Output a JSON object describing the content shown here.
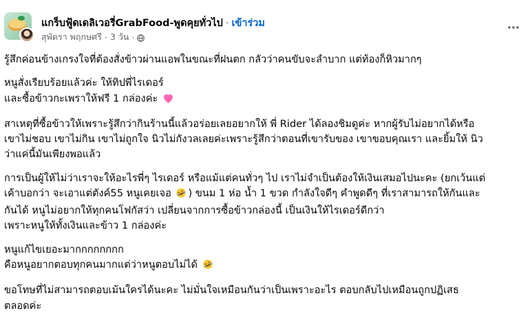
{
  "post": {
    "group_name": "แกร็บฟู้ดเดลิเวอรี่GrabFood-พูดคุยทั่วไป",
    "separator": "·",
    "join_label": "เข้าร่วม",
    "author": "สุพัตรา พฤกษศรี",
    "time": "3 วัน",
    "privacy_icon": "globe-icon",
    "more_icon": "more-options-icon",
    "paragraphs": [
      {
        "lines": [
          "รู้สึกค่อนข้างเกรงใจที่ต้องสั่งข้าวผ่านแอพในขณะที่ฝนตก กลัวว่าคนขับจะลำบาก แต่ท้องก็หิวมากๆ"
        ]
      },
      {
        "lines": [
          "หนูสั่งเรียบร้อยแล้วค่ะ ให้ทิปพี่ไรเดอร์",
          "และซื้อข้าวกะเพราให้ฟรี 1 กล่องค่ะ"
        ],
        "trailing_emoji": "pink-heart-emoji"
      },
      {
        "lines": [
          "สาเหตุที่ซื้อข้าวให้เพราะรู้สึกว่ากินร้านนี้แล้วอร่อยเลยอยากให้ พี่ Rider ได้ลองชิมดูค่ะ หากผู้รับไม่อยากได้หรือ",
          "เขาไม่ชอบ เขาไม่กิน เขาไม่ถูกใจ นิวไม่กังวลเลยค่ะเพราะรู้สึกว่าตอนที่เขารับของ เขาขอบคุณเรา และยิ้มให้ นิว",
          "ว่าแค่นี้มันเพียงพอแล้ว"
        ]
      },
      {
        "lines_parts": [
          [
            "การเป็นผู้ให้ไม่ว่าเราจะให้อะไรพี่ๆ ไรเดอร์ หรือแม้แต่คนทั่วๆ ไป เราไม่จำเป็นต้องให้เงินเสมอไปนะคะ (ยกเว้นแต่"
          ],
          [
            "เค้าบอกว่า จะเอาแต่ตังค์55 หนูเคยเจอ ",
            "@rofl",
            ")  ขนม 1 ห่อ น้ำ 1 ขวด กำลังใจดีๆ  คำพูดดีๆ ที่เราสามารถให้กันและ"
          ],
          [
            "กันได้  หนูไม่อยากให้ทุกคนโฟกัสว่า เปลี่ยนจากการซื้อข้าวกล่องนี้ เป็นเงินให้ไรเดอร์ดีกว่า"
          ],
          [
            "เพราะหนูให้ทั้งเงินและข้าว 1 กล่องค่ะ"
          ]
        ]
      },
      {
        "lines_parts": [
          [
            "หนูแก้ไขเยอะมากกกกกกกก"
          ],
          [
            "คือหนูอยากตอบทุกคนมากแต่ว่าหนูตอบไม่ได้ ",
            "@rofl"
          ]
        ]
      },
      {
        "lines": [
          "ขอโทษที่ไม่สามารถตอบเม้นใครได้นะคะ ไม่มั่นใจเหมือนกันว่าเป็นเพราะอะไร ตอบกลับไปเหมือนถูกปฏิเสธ",
          "ตลอดค่ะ"
        ]
      }
    ]
  },
  "colors": {
    "text": "#050505",
    "meta": "#65676b",
    "link": "#0064d1",
    "heart": "#ff66b3"
  }
}
